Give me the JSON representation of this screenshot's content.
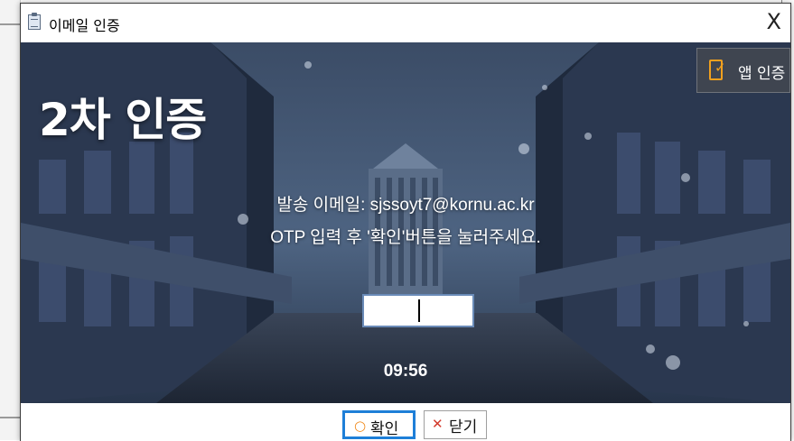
{
  "window": {
    "title": "이메일 인증",
    "close_glyph": "X"
  },
  "scene": {
    "headline": "2차 인증",
    "app_auth_label": "앱 인증",
    "message_line1": "발송 이메일: sjssoyt7@kornu.ac.kr",
    "message_line2": "OTP 입력 후 '확인'버튼을 눌러주세요.",
    "otp_value": "",
    "timer": "09:56"
  },
  "buttons": {
    "ok_label": "확인",
    "close_label": "닫기"
  },
  "icons": {
    "title": "email-document-icon",
    "app_auth": "phone-check-icon",
    "ok": "circle-icon",
    "close": "x-icon"
  },
  "colors": {
    "ok_border": "#1e7fd8",
    "ok_icon": "#f08a1c",
    "close_icon": "#d33a2c",
    "app_auth_icon": "#f0a01e"
  }
}
